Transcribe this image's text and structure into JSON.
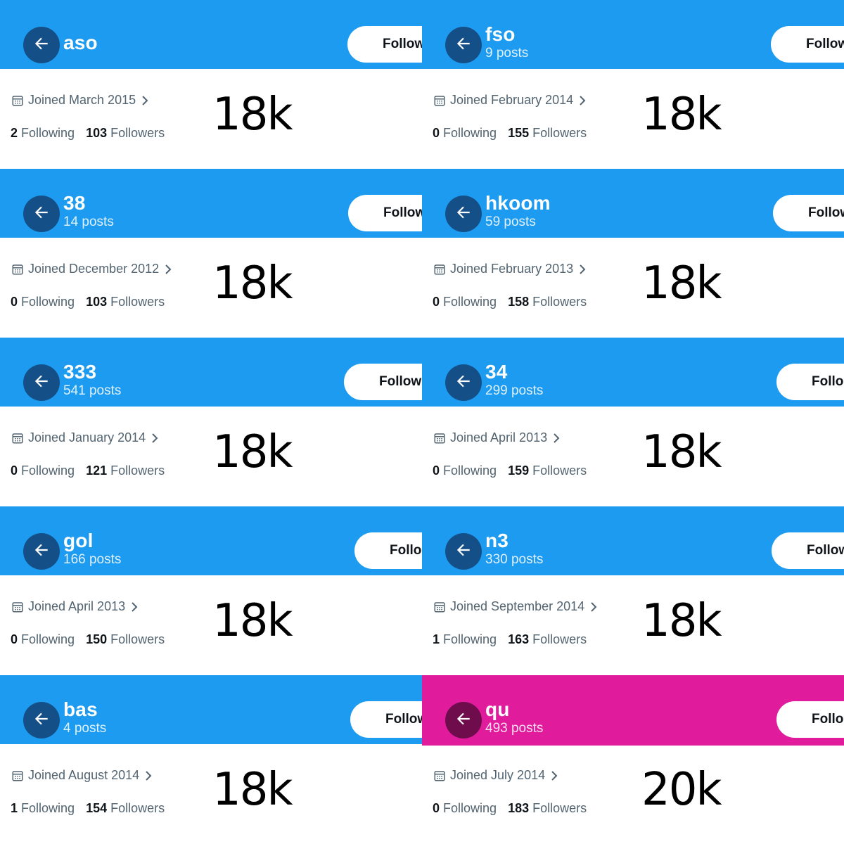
{
  "colors": {
    "header_blue": "#1d9bf0",
    "header_pink": "#e01b9c",
    "back_blue": "#154f87",
    "back_pink": "#6e0c4c"
  },
  "icons": {
    "back": "arrow-left-icon",
    "calendar": "calendar-icon",
    "chevron": "chevron-right-icon"
  },
  "tiles": [
    {
      "name": "aso",
      "posts": "",
      "follow": "Follow",
      "joined": "Joined March 2015",
      "following_count": "2",
      "following_label": "Following",
      "followers_count": "103",
      "followers_label": "Followers",
      "big": "18k"
    },
    {
      "name": "fso",
      "posts": "9 posts",
      "follow": "Follow",
      "joined": "Joined February 2014",
      "following_count": "0",
      "following_label": "Following",
      "followers_count": "155",
      "followers_label": "Followers",
      "big": "18k"
    },
    {
      "name": "38",
      "posts": "14 posts",
      "follow": "Follow",
      "joined": "Joined December 2012",
      "following_count": "0",
      "following_label": "Following",
      "followers_count": "103",
      "followers_label": "Followers",
      "big": "18k"
    },
    {
      "name": "hkoom",
      "posts": "59 posts",
      "follow": "Follow",
      "joined": "Joined February 2013",
      "following_count": "0",
      "following_label": "Following",
      "followers_count": "158",
      "followers_label": "Followers",
      "big": "18k"
    },
    {
      "name": "333",
      "posts": "541 posts",
      "follow": "Follow",
      "joined": "Joined January 2014",
      "following_count": "0",
      "following_label": "Following",
      "followers_count": "121",
      "followers_label": "Followers",
      "big": "18k"
    },
    {
      "name": "34",
      "posts": "299 posts",
      "follow": "Follo",
      "joined": "Joined April 2013",
      "following_count": "0",
      "following_label": "Following",
      "followers_count": "159",
      "followers_label": "Followers",
      "big": "18k"
    },
    {
      "name": "gol",
      "posts": "166 posts",
      "follow": "Follo",
      "joined": "Joined April 2013",
      "following_count": "0",
      "following_label": "Following",
      "followers_count": "150",
      "followers_label": "Followers",
      "big": "18k"
    },
    {
      "name": "n3",
      "posts": "330 posts",
      "follow": "Follow",
      "joined": "Joined September 2014",
      "following_count": "1",
      "following_label": "Following",
      "followers_count": "163",
      "followers_label": "Followers",
      "big": "18k"
    },
    {
      "name": "bas",
      "posts": "4 posts",
      "follow": "Follow",
      "joined": "Joined August 2014",
      "following_count": "1",
      "following_label": "Following",
      "followers_count": "154",
      "followers_label": "Followers",
      "big": "18k"
    },
    {
      "name": "qu",
      "posts": "493 posts",
      "follow": "Follo",
      "joined": "Joined July 2014",
      "following_count": "0",
      "following_label": "Following",
      "followers_count": "183",
      "followers_label": "Followers",
      "big": "20k"
    }
  ]
}
